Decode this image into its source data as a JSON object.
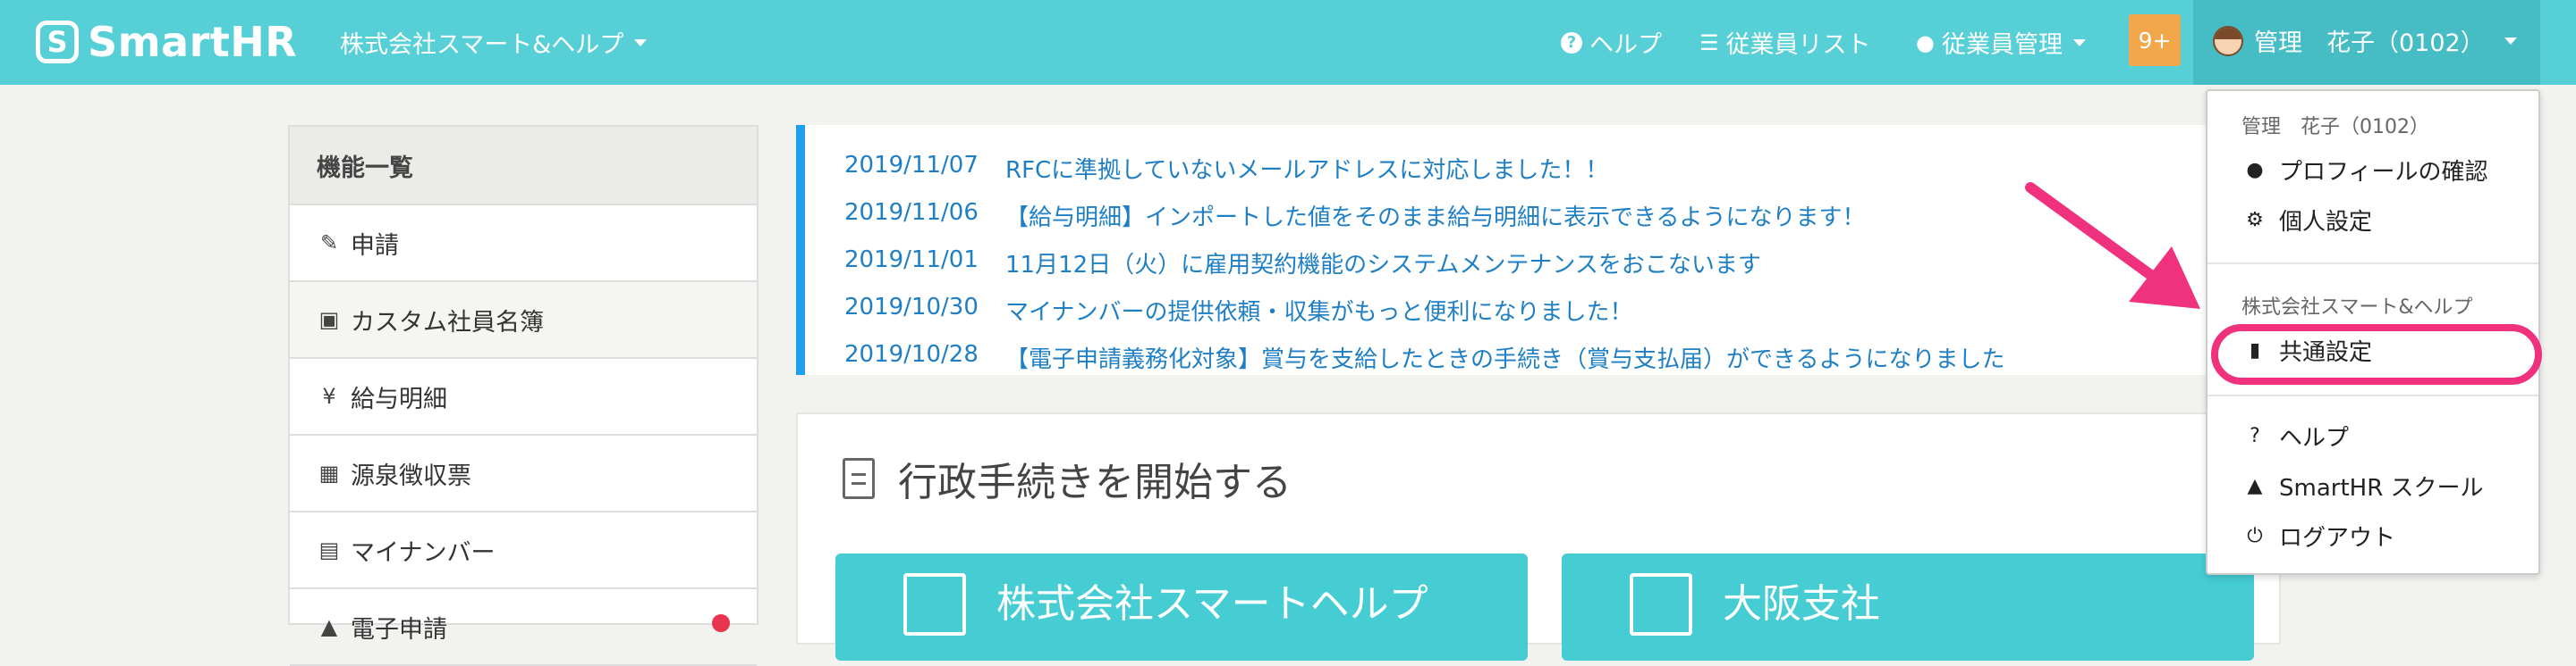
{
  "header": {
    "logo_mark": "S",
    "logo_text": "SmartHR",
    "company": "株式会社スマート&ヘルプ",
    "nav": {
      "help": "ヘルプ",
      "employee_list": "従業員リスト",
      "employee_management": "従業員管理"
    },
    "notification_badge": "9+",
    "user_name": "管理　花子（0102）"
  },
  "sidebar": {
    "title": "機能一覧",
    "items": [
      {
        "label": "申請",
        "icon": "form-icon"
      },
      {
        "label": "カスタム社員名簿",
        "icon": "id-card-icon"
      },
      {
        "label": "給与明細",
        "icon": "yen-bag-icon"
      },
      {
        "label": "源泉徴収票",
        "icon": "calculator-icon"
      },
      {
        "label": "マイナンバー",
        "icon": "card-icon"
      },
      {
        "label": "電子申請",
        "icon": "mortarboard-icon"
      }
    ]
  },
  "news": [
    {
      "date": "2019/11/07",
      "text": "RFCに準拠していないメールアドレスに対応しました！！"
    },
    {
      "date": "2019/11/06",
      "text": "【給与明細】インポートした値をそのまま給与明細に表示できるようになります！"
    },
    {
      "date": "2019/11/01",
      "text": "11月12日（火）に雇用契約機能のシステムメンテナンスをおこないます"
    },
    {
      "date": "2019/10/30",
      "text": "マイナンバーの提供依頼・収集がもっと便利になりました！"
    },
    {
      "date": "2019/10/28",
      "text": "【電子申請義務化対象】賞与を支給したときの手続き（賞与支払届）ができるようになりました"
    }
  ],
  "procedures": {
    "title": "行政手続きを開始する",
    "tiles": [
      "株式会社スマートヘルプ",
      "大阪支社"
    ]
  },
  "dropdown": {
    "user_label": "管理　花子（0102）",
    "profile": "プロフィールの確認",
    "personal_settings": "個人設定",
    "company_label": "株式会社スマート&ヘルプ",
    "common_settings": "共通設定",
    "help": "ヘルプ",
    "school": "SmartHR スクール",
    "logout": "ログアウト"
  },
  "colors": {
    "header": "#56cfd6",
    "accent_pink": "#f0317e",
    "badge": "#f3a74b",
    "news_link": "#1f7fc5"
  }
}
